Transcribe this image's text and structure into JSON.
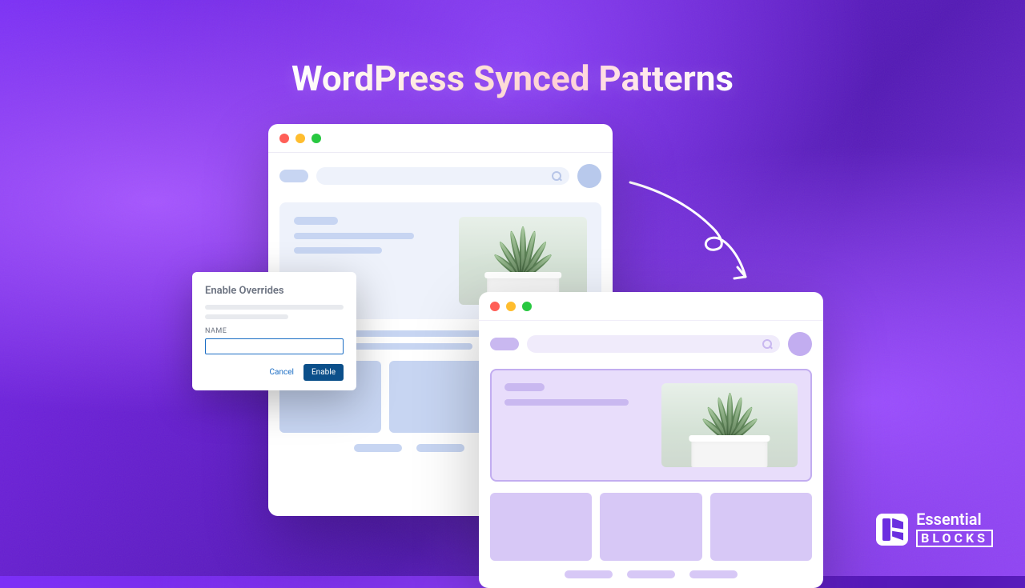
{
  "title": "WordPress Synced Patterns",
  "dialog": {
    "title": "Enable Overrides",
    "field_label": "NAME",
    "input_placeholder": "",
    "cancel": "Cancel",
    "enable": "Enable"
  },
  "brand": {
    "name": "Essential",
    "sub": "BLOCKS"
  },
  "colors": {
    "back_accent": "#c7d5f2",
    "front_accent": "#c9b8f0"
  }
}
